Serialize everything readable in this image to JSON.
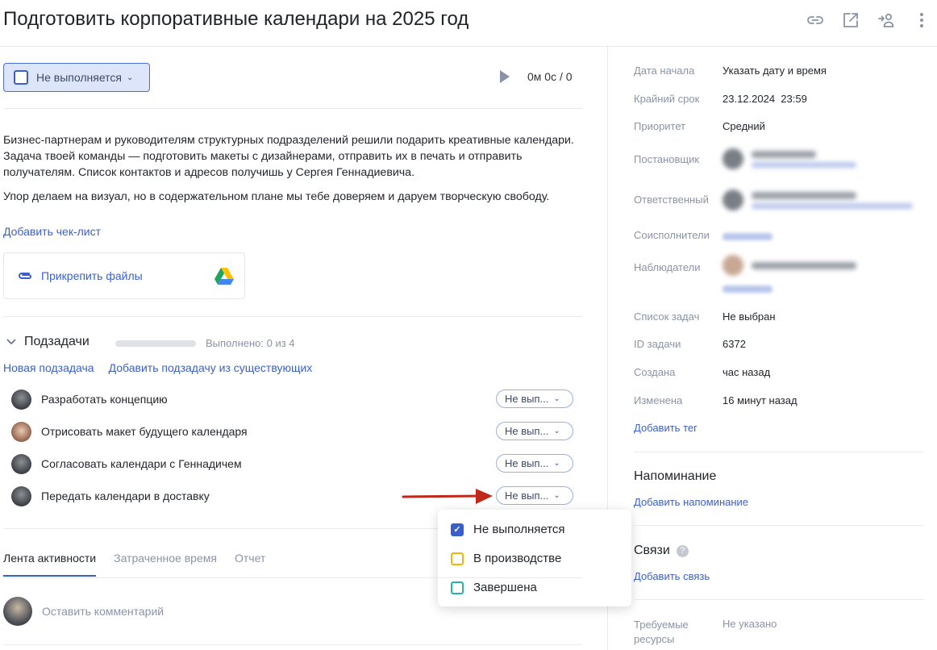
{
  "header": {
    "title": "Подготовить корпоративные календари на 2025 год",
    "icons": [
      "link-icon",
      "open-external-icon",
      "reassign-icon",
      "more-icon"
    ]
  },
  "status": {
    "label": "Не выполняется"
  },
  "timer": {
    "value": "0м 0с / 0"
  },
  "description": {
    "p1": "Бизнес-партнерам и руководителям структурных подразделений решили подарить креативные календари. Задача твоей команды — подготовить макеты с дизайнерами, отправить их в печать и отправить получателям. Список контактов и адресов получишь у Сергея Геннадиевича.",
    "p2": "Упор делаем на визуал, но в содержательном плане мы тебе доверяем и даруем творческую свободу."
  },
  "add_checklist": "Добавить чек-лист",
  "attach": {
    "label": "Прикрепить файлы"
  },
  "subtasks": {
    "title": "Подзадачи",
    "progress_done": 0,
    "progress_total": 4,
    "done_text": "Выполнено: 0 из 4",
    "new_link": "Новая подзадача",
    "add_existing_link": "Добавить подзадачу из существующих",
    "items": [
      {
        "name": "Разработать концепцию",
        "status": "Не вып..."
      },
      {
        "name": "Отрисовать макет будущего календаря",
        "status": "Не вып..."
      },
      {
        "name": "Согласовать календари с Геннадичем",
        "status": "Не вып..."
      },
      {
        "name": "Передать календари в доставку",
        "status": "Не вып..."
      }
    ]
  },
  "status_dropdown": {
    "options": [
      {
        "label": "Не выполняется",
        "checked": true,
        "color": "#3b5fc9"
      },
      {
        "label": "В производстве",
        "checked": false,
        "color": "#f5b40a"
      },
      {
        "label": "Завершена",
        "checked": false,
        "color": "#22b5a5"
      }
    ]
  },
  "tabs": [
    "Лента активности",
    "Затраченное время",
    "Отчет"
  ],
  "comment": {
    "placeholder": "Оставить комментарий"
  },
  "props": {
    "start_label": "Дата начала",
    "start_value": "Указать дату и время",
    "deadline_label": "Крайний срок",
    "deadline_value": "23.12.2024  23:59",
    "priority_label": "Приоритет",
    "priority_value": "Средний",
    "creator_label": "Постановщик",
    "assignee_label": "Ответственный",
    "coexecutors_label": "Соисполнители",
    "observers_label": "Наблюдатели",
    "tasklist_label": "Список задач",
    "tasklist_value": "Не выбран",
    "id_label": "ID задачи",
    "id_value": "6372",
    "created_label": "Создана",
    "created_value": "час назад",
    "modified_label": "Изменена",
    "modified_value": "16 минут назад",
    "add_tag": "Добавить тег"
  },
  "reminder": {
    "title": "Напоминание",
    "add": "Добавить напоминание"
  },
  "relations": {
    "title": "Связи",
    "add": "Добавить связь"
  },
  "resources": {
    "label": "Требуемые ресурсы",
    "value": "Не указано"
  },
  "colors": {
    "accent": "#3b5fc9",
    "arrow": "#c0281c"
  }
}
